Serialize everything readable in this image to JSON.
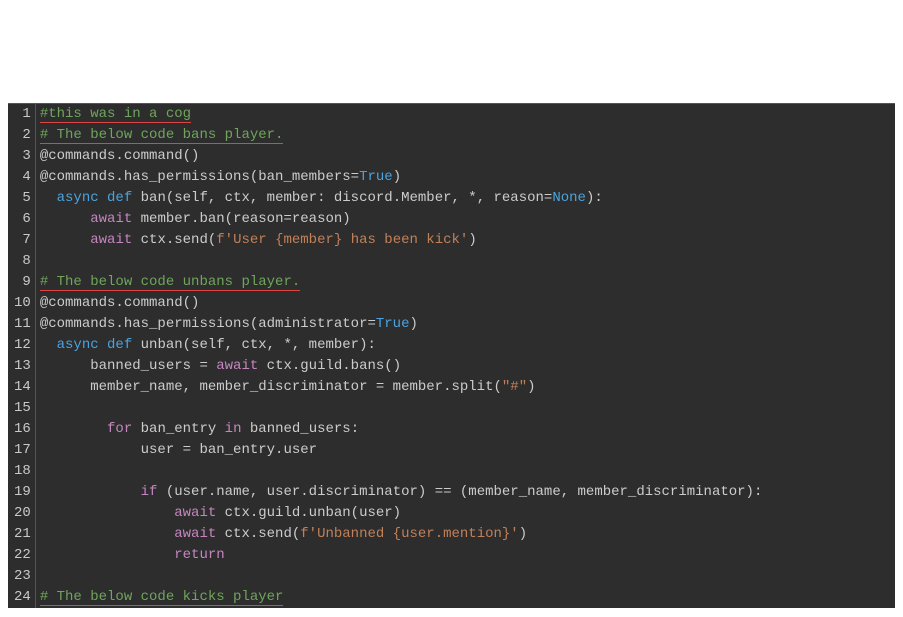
{
  "editor": {
    "language": "python",
    "lines": [
      {
        "n": 1,
        "segments": [
          {
            "cls": "tok-cm underline-red",
            "t": "#this was in a cog"
          }
        ]
      },
      {
        "n": 2,
        "segments": [
          {
            "cls": "tok-cm underline-red",
            "t": "# The below code bans player."
          }
        ]
      },
      {
        "n": 3,
        "segments": [
          {
            "cls": "",
            "t": "@commands.command()"
          }
        ]
      },
      {
        "n": 4,
        "segments": [
          {
            "cls": "",
            "t": "@commands.has_permissions(ban_members="
          },
          {
            "cls": "tok-kw",
            "t": "True"
          },
          {
            "cls": "",
            "t": ")"
          }
        ]
      },
      {
        "n": 5,
        "segments": [
          {
            "cls": "",
            "t": "  "
          },
          {
            "cls": "tok-kw",
            "t": "async def"
          },
          {
            "cls": "",
            "t": " ban(self, ctx, member: discord.Member, *, reason="
          },
          {
            "cls": "tok-kw",
            "t": "None"
          },
          {
            "cls": "",
            "t": "):"
          }
        ]
      },
      {
        "n": 6,
        "segments": [
          {
            "cls": "",
            "t": "      "
          },
          {
            "cls": "tok-kw2",
            "t": "await"
          },
          {
            "cls": "",
            "t": " member.ban(reason=reason)"
          }
        ]
      },
      {
        "n": 7,
        "segments": [
          {
            "cls": "",
            "t": "      "
          },
          {
            "cls": "tok-kw2",
            "t": "await"
          },
          {
            "cls": "",
            "t": " ctx.send("
          },
          {
            "cls": "tok-str",
            "t": "f'User {member} has been kick'"
          },
          {
            "cls": "",
            "t": ")"
          }
        ]
      },
      {
        "n": 8,
        "segments": [
          {
            "cls": "",
            "t": ""
          }
        ]
      },
      {
        "n": 9,
        "segments": [
          {
            "cls": "tok-cm underline-red",
            "t": "# The below code unbans player."
          }
        ]
      },
      {
        "n": 10,
        "segments": [
          {
            "cls": "",
            "t": "@commands.command()"
          }
        ]
      },
      {
        "n": 11,
        "segments": [
          {
            "cls": "",
            "t": "@commands.has_permissions(administrator="
          },
          {
            "cls": "tok-kw",
            "t": "True"
          },
          {
            "cls": "",
            "t": ")"
          }
        ]
      },
      {
        "n": 12,
        "segments": [
          {
            "cls": "",
            "t": "  "
          },
          {
            "cls": "tok-kw",
            "t": "async def"
          },
          {
            "cls": "",
            "t": " unban(self, ctx, *, member):"
          }
        ]
      },
      {
        "n": 13,
        "segments": [
          {
            "cls": "",
            "t": "      banned_users = "
          },
          {
            "cls": "tok-kw2",
            "t": "await"
          },
          {
            "cls": "",
            "t": " ctx.guild.bans()"
          }
        ]
      },
      {
        "n": 14,
        "segments": [
          {
            "cls": "",
            "t": "      member_name, member_discriminator = member.split("
          },
          {
            "cls": "tok-str",
            "t": "\"#\""
          },
          {
            "cls": "",
            "t": ")"
          }
        ]
      },
      {
        "n": 15,
        "segments": [
          {
            "cls": "",
            "t": ""
          }
        ]
      },
      {
        "n": 16,
        "segments": [
          {
            "cls": "",
            "t": "        "
          },
          {
            "cls": "tok-kw2",
            "t": "for"
          },
          {
            "cls": "",
            "t": " ban_entry "
          },
          {
            "cls": "tok-kw2",
            "t": "in"
          },
          {
            "cls": "",
            "t": " banned_users:"
          }
        ]
      },
      {
        "n": 17,
        "segments": [
          {
            "cls": "",
            "t": "            user = ban_entry.user"
          }
        ]
      },
      {
        "n": 18,
        "segments": [
          {
            "cls": "",
            "t": ""
          }
        ]
      },
      {
        "n": 19,
        "segments": [
          {
            "cls": "",
            "t": "            "
          },
          {
            "cls": "tok-kw2",
            "t": "if"
          },
          {
            "cls": "",
            "t": " (user.name, user.discriminator) == (member_name, member_discriminator):"
          }
        ]
      },
      {
        "n": 20,
        "segments": [
          {
            "cls": "",
            "t": "                "
          },
          {
            "cls": "tok-kw2",
            "t": "await"
          },
          {
            "cls": "",
            "t": " ctx.guild.unban(user)"
          }
        ]
      },
      {
        "n": 21,
        "segments": [
          {
            "cls": "",
            "t": "                "
          },
          {
            "cls": "tok-kw2",
            "t": "await"
          },
          {
            "cls": "",
            "t": " ctx.send("
          },
          {
            "cls": "tok-str",
            "t": "f'Unbanned {user.mention}'"
          },
          {
            "cls": "",
            "t": ")"
          }
        ]
      },
      {
        "n": 22,
        "segments": [
          {
            "cls": "",
            "t": "                "
          },
          {
            "cls": "tok-kw2",
            "t": "return"
          }
        ]
      },
      {
        "n": 23,
        "segments": [
          {
            "cls": "",
            "t": ""
          }
        ]
      },
      {
        "n": 24,
        "segments": [
          {
            "cls": "tok-cm underline-red",
            "t": "# The below code kicks player"
          }
        ]
      }
    ]
  }
}
